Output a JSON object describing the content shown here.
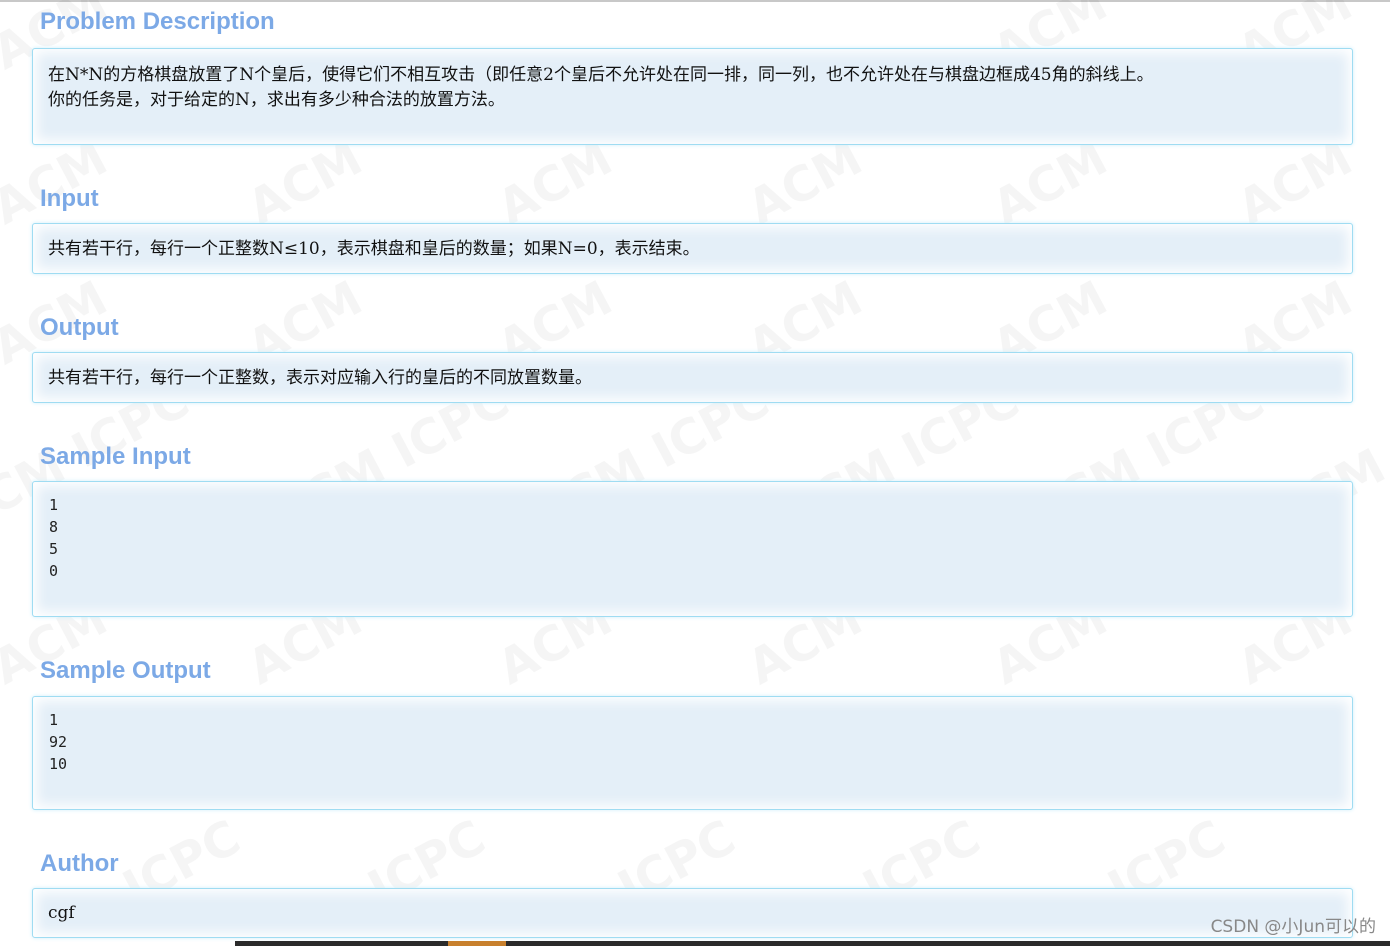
{
  "problem": {
    "description_title": "Problem Description",
    "description_lines": [
      "在N*N的方格棋盘放置了N个皇后，使得它们不相互攻击（即任意2个皇后不允许处在同一排，同一列，也不允许处在与棋盘边框成45角的斜线上。",
      "你的任务是，对于给定的N，求出有多少种合法的放置方法。"
    ],
    "input_title": "Input",
    "input_text": "共有若干行，每行一个正整数N≤10，表示棋盘和皇后的数量；如果N=0，表示结束。",
    "output_title": "Output",
    "output_text": "共有若干行，每行一个正整数，表示对应输入行的皇后的不同放置数量。",
    "sample_input_title": "Sample Input",
    "sample_input_lines": [
      "1",
      "8",
      "5",
      "0"
    ],
    "sample_output_title": "Sample Output",
    "sample_output_lines": [
      "1",
      "92",
      "10"
    ],
    "author_title": "Author",
    "author_text": "cgf"
  },
  "watermark": {
    "acm": "ACM",
    "acm_icpc": "ACM ICPC",
    "icpc": "ICPC"
  },
  "credit": "CSDN @小Jun可以的",
  "colors": {
    "title": "#7ca9e6",
    "panel_bg": "#e4eff8",
    "panel_border": "#9fdcf2"
  }
}
